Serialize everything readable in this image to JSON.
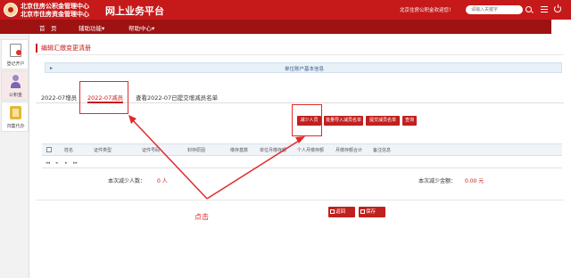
{
  "header": {
    "org_line1": "北京住房公积金管理中心",
    "org_line2": "北京市住房资金管理中心",
    "platform": "网上业务平台",
    "welcome": "北京住房公积金欢迎您！",
    "search_placeholder": "请输入关键字"
  },
  "nav": {
    "items": [
      "首　页",
      "辅助功能▾",
      "帮助中心▾"
    ]
  },
  "sidebar": {
    "items": [
      "登记开户",
      "公积金",
      "归集代办"
    ]
  },
  "page": {
    "title": "编辑汇缴变更清册",
    "info_bar": "单位账户基本信息"
  },
  "tabs": [
    "2022-07增员",
    "2022-07减员",
    "查看2022-07已提交增减员名单"
  ],
  "actions": [
    "减少人员",
    "批量导入减员名单",
    "提交减员名单",
    "查询"
  ],
  "grid": {
    "columns": [
      "姓名",
      "证件类型",
      "证件号码",
      "封存原因",
      "缴存基数",
      "单位月缴存额",
      "个人月缴存额",
      "月缴存额合计",
      "备注信息"
    ],
    "pager": [
      "◂◂",
      "◂",
      "▸",
      "▸▸"
    ]
  },
  "summary": {
    "count_label": "本次减少人数：",
    "count_value": "0 人",
    "amount_label": "本次减少金额：",
    "amount_value": "0.00 元"
  },
  "footer": {
    "back": "返回",
    "save": "保存"
  },
  "annotation": {
    "note": "点击",
    "color": "#e02a2a"
  },
  "colors": {
    "brand": "#c61a1a",
    "nav": "#9e1212"
  }
}
